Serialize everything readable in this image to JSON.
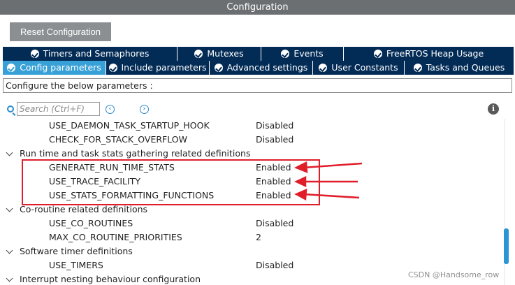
{
  "window": {
    "title": "Configuration"
  },
  "toolbar": {
    "reset_label": "Reset Configuration"
  },
  "tabs_row1": [
    {
      "label": "Timers and Semaphores"
    },
    {
      "label": "Mutexes"
    },
    {
      "label": "Events"
    },
    {
      "label": "FreeRTOS Heap Usage"
    }
  ],
  "tabs_row2": [
    {
      "label": "Config parameters",
      "active": true
    },
    {
      "label": "Include parameters"
    },
    {
      "label": "Advanced settings"
    },
    {
      "label": "User Constants"
    },
    {
      "label": "Tasks and Queues"
    }
  ],
  "description": "Configure the below parameters :",
  "search": {
    "placeholder": "Search (Ctrl+F)",
    "value": ""
  },
  "params": [
    {
      "kind": "item",
      "name": "USE_DAEMON_TASK_STARTUP_HOOK",
      "value": "Disabled"
    },
    {
      "kind": "item",
      "name": "CHECK_FOR_STACK_OVERFLOW",
      "value": "Disabled"
    },
    {
      "kind": "group",
      "name": "Run time and task stats gathering related definitions"
    },
    {
      "kind": "item",
      "name": "GENERATE_RUN_TIME_STATS",
      "value": "Enabled"
    },
    {
      "kind": "item",
      "name": "USE_TRACE_FACILITY",
      "value": "Enabled"
    },
    {
      "kind": "item",
      "name": "USE_STATS_FORMATTING_FUNCTIONS",
      "value": "Enabled"
    },
    {
      "kind": "group",
      "name": "Co-routine related definitions"
    },
    {
      "kind": "item",
      "name": "USE_CO_ROUTINES",
      "value": "Disabled"
    },
    {
      "kind": "item",
      "name": "MAX_CO_ROUTINE_PRIORITIES",
      "value": "2"
    },
    {
      "kind": "group",
      "name": "Software timer definitions"
    },
    {
      "kind": "item",
      "name": "USE_TIMERS",
      "value": "Disabled"
    },
    {
      "kind": "group",
      "name": "Interrupt nesting behaviour configuration"
    }
  ],
  "watermark": "CSDN @Handsome_row",
  "colors": {
    "titlebar": "#6c6f72",
    "tab_inactive": "#022b56",
    "tab_active": "#37a0d6",
    "annotation": "#e01e2a",
    "accent": "#2b95d6"
  }
}
